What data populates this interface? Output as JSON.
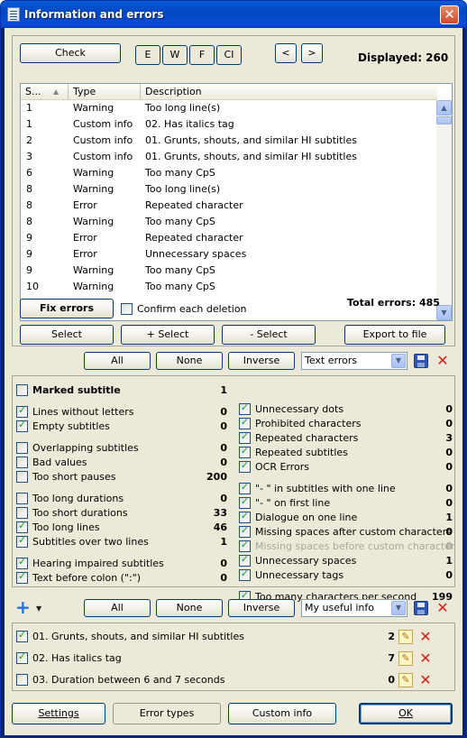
{
  "window": {
    "title": "Information and errors"
  },
  "toolbar": {
    "check_label": "Check",
    "filters": [
      "E",
      "W",
      "F",
      "CI"
    ],
    "prev_label": "<",
    "next_label": ">",
    "displayed_text": "Displayed: 260"
  },
  "table": {
    "columns": [
      "S...",
      "Type",
      "Description"
    ],
    "rows": [
      {
        "s": "1",
        "type": "Warning",
        "desc": "Too long line(s)"
      },
      {
        "s": "1",
        "type": "Custom info",
        "desc": "02. Has italics tag"
      },
      {
        "s": "2",
        "type": "Custom info",
        "desc": "01. Grunts, shouts, and similar HI subtitles"
      },
      {
        "s": "3",
        "type": "Custom info",
        "desc": "01. Grunts, shouts, and similar HI subtitles"
      },
      {
        "s": "6",
        "type": "Warning",
        "desc": "Too many CpS"
      },
      {
        "s": "8",
        "type": "Warning",
        "desc": "Too long line(s)"
      },
      {
        "s": "8",
        "type": "Error",
        "desc": "Repeated character"
      },
      {
        "s": "8",
        "type": "Warning",
        "desc": "Too many CpS"
      },
      {
        "s": "9",
        "type": "Error",
        "desc": "Repeated character"
      },
      {
        "s": "9",
        "type": "Error",
        "desc": "Unnecessary spaces"
      },
      {
        "s": "9",
        "type": "Warning",
        "desc": "Too many CpS"
      },
      {
        "s": "10",
        "type": "Warning",
        "desc": "Too many CpS"
      }
    ]
  },
  "actions": {
    "fix_errors": "Fix errors",
    "confirm_each_deletion": "Confirm each deletion",
    "total_errors": "Total errors: 485",
    "select": "Select",
    "plus_select": "+ Select",
    "minus_select": "- Select",
    "export": "Export to file"
  },
  "errors_section": {
    "all": "All",
    "none": "None",
    "inverse": "Inverse",
    "preset": "Text errors",
    "left": [
      {
        "label": "Marked subtitle",
        "checked": false,
        "count": "1",
        "bold": true
      },
      {
        "label": "Lines without letters",
        "checked": true,
        "count": "0"
      },
      {
        "label": "Empty subtitles",
        "checked": true,
        "count": "0"
      },
      {
        "label": "Overlapping subtitles",
        "checked": false,
        "count": "0"
      },
      {
        "label": "Bad values",
        "checked": false,
        "count": "0"
      },
      {
        "label": "Too short pauses",
        "checked": false,
        "count": "200"
      },
      {
        "label": "Too long durations",
        "checked": false,
        "count": "0"
      },
      {
        "label": "Too short durations",
        "checked": false,
        "count": "33"
      },
      {
        "label": "Too long lines",
        "checked": true,
        "count": "46"
      },
      {
        "label": "Subtitles over two lines",
        "checked": true,
        "count": "1"
      },
      {
        "label": "Hearing impaired subtitles",
        "checked": true,
        "count": "0"
      },
      {
        "label": "Text before colon (\":\")",
        "checked": true,
        "count": "0"
      }
    ],
    "right": [
      {
        "label": "Unnecessary dots",
        "checked": true,
        "count": "0"
      },
      {
        "label": "Prohibited characters",
        "checked": true,
        "count": "0"
      },
      {
        "label": "Repeated characters",
        "checked": true,
        "count": "3"
      },
      {
        "label": "Repeated subtitles",
        "checked": true,
        "count": "0"
      },
      {
        "label": "OCR Errors",
        "checked": true,
        "count": "0"
      },
      {
        "label": "\"- \" in subtitles with one line",
        "checked": true,
        "count": "0"
      },
      {
        "label": "\"- \" on first line",
        "checked": true,
        "count": "0"
      },
      {
        "label": "Dialogue on one line",
        "checked": true,
        "count": "1"
      },
      {
        "label": "Missing spaces after custom characters",
        "checked": true,
        "count": "0"
      },
      {
        "label": "Missing spaces before custom character",
        "checked": true,
        "count": "0",
        "disabled": true
      },
      {
        "label": "Unnecessary spaces",
        "checked": true,
        "count": "1"
      },
      {
        "label": "Unnecessary tags",
        "checked": true,
        "count": "0"
      },
      {
        "label": "Too many characters per second",
        "checked": true,
        "count": "199"
      }
    ]
  },
  "custom_section": {
    "all": "All",
    "none": "None",
    "inverse": "Inverse",
    "preset": "My useful info",
    "items": [
      {
        "label": "01. Grunts, shouts, and similar HI subtitles",
        "checked": true,
        "count": "2"
      },
      {
        "label": "02. Has italics tag",
        "checked": true,
        "count": "7"
      },
      {
        "label": "03. Duration between 6 and 7 seconds",
        "checked": false,
        "count": "0"
      }
    ]
  },
  "bottom": {
    "settings": "Settings",
    "error_types": "Error types",
    "custom_info": "Custom info",
    "ok": "OK"
  }
}
